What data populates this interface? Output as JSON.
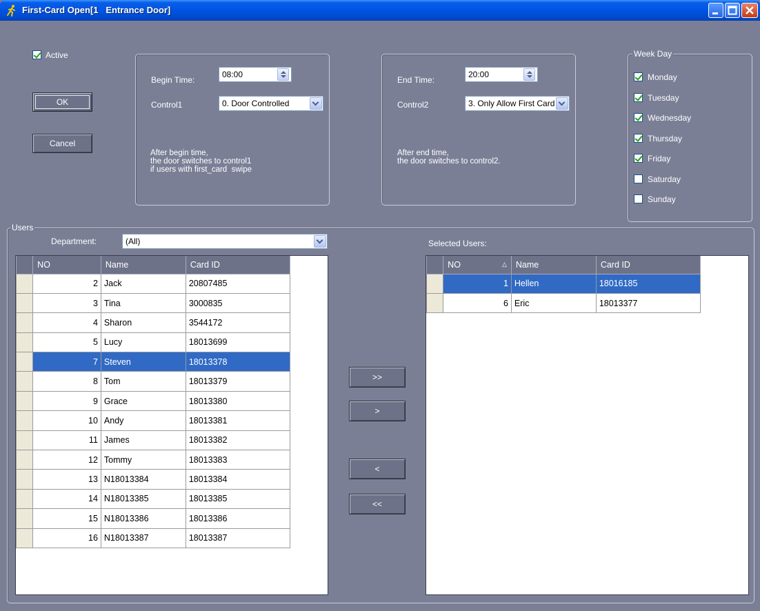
{
  "window": {
    "title": "First-Card Open[1   Entrance Door]"
  },
  "active": {
    "label": "Active",
    "checked": true
  },
  "buttons": {
    "ok": "OK",
    "cancel": "Cancel"
  },
  "begin": {
    "time_label": "Begin Time:",
    "time_value": "08:00",
    "control_label": "Control1",
    "control_value": "0. Door Controlled",
    "note_lines": [
      "After begin time,",
      "the door switches to control1",
      "if users with first_card  swipe"
    ]
  },
  "end": {
    "time_label": "End Time:",
    "time_value": "20:00",
    "control_label": "Control2",
    "control_value": "3. Only Allow First Card",
    "note_lines": [
      "After end time,",
      "the door switches to control2."
    ]
  },
  "weekday": {
    "legend": "Week Day",
    "days": [
      {
        "label": "Monday",
        "checked": true
      },
      {
        "label": "Tuesday",
        "checked": true
      },
      {
        "label": "Wednesday",
        "checked": true
      },
      {
        "label": "Thursday",
        "checked": true
      },
      {
        "label": "Friday",
        "checked": true
      },
      {
        "label": "Saturday",
        "checked": false
      },
      {
        "label": "Sunday",
        "checked": false
      }
    ]
  },
  "users": {
    "legend": "Users",
    "department_label": "Department:",
    "department_value": "(All)",
    "columns": [
      "NO",
      "Name",
      "Card ID"
    ],
    "rows": [
      {
        "no": "2",
        "name": "Jack",
        "card": "20807485"
      },
      {
        "no": "3",
        "name": "Tina",
        "card": "3000835"
      },
      {
        "no": "4",
        "name": "Sharon",
        "card": "3544172"
      },
      {
        "no": "5",
        "name": "Lucy",
        "card": "18013699"
      },
      {
        "no": "7",
        "name": "Steven",
        "card": "18013378",
        "selected": true
      },
      {
        "no": "8",
        "name": "Tom",
        "card": "18013379"
      },
      {
        "no": "9",
        "name": "Grace",
        "card": "18013380"
      },
      {
        "no": "10",
        "name": "Andy",
        "card": "18013381"
      },
      {
        "no": "11",
        "name": "James",
        "card": "18013382"
      },
      {
        "no": "12",
        "name": "Tommy",
        "card": "18013383"
      },
      {
        "no": "13",
        "name": "N18013384",
        "card": "18013384"
      },
      {
        "no": "14",
        "name": "N18013385",
        "card": "18013385"
      },
      {
        "no": "15",
        "name": "N18013386",
        "card": "18013386"
      },
      {
        "no": "16",
        "name": "N18013387",
        "card": "18013387"
      }
    ]
  },
  "selected": {
    "label": "Selected Users:",
    "columns": [
      "NO",
      "Name",
      "Card ID"
    ],
    "rows": [
      {
        "no": "1",
        "name": "Hellen",
        "card": "18016185",
        "selected": true
      },
      {
        "no": "6",
        "name": "Eric",
        "card": "18013377"
      }
    ]
  },
  "transfer": {
    "add_all": ">>",
    "add": ">",
    "remove": "<",
    "remove_all": "<<"
  }
}
